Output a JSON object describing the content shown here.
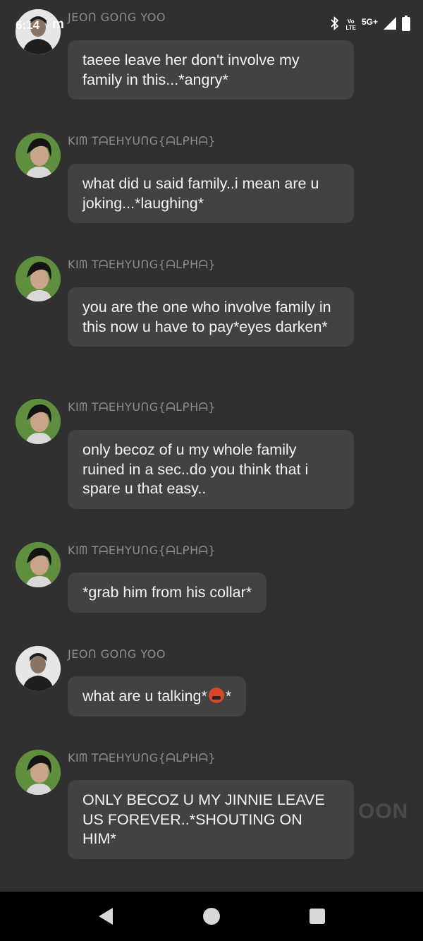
{
  "status_bar": {
    "time": "6:14",
    "app_icon": "m",
    "volte_top": "Vo",
    "volte_bottom": "LTE",
    "network": "5G+",
    "icons": [
      "bluetooth-icon",
      "signal-icon",
      "battery-icon"
    ]
  },
  "messages": [
    {
      "sender": "JEOᑎ GOᑎG YOO",
      "avatar": "gong-avatar",
      "text": "taeee leave her don't involve my family in this...*angry*"
    },
    {
      "sender": "KIᗰ TᗩEHYUᑎG{ᗩᒪᑭHᗩ}",
      "avatar": "taehyung-avatar",
      "text": "what did u said family..i mean are u joking...*laughing*"
    },
    {
      "sender": "KIᗰ TᗩEHYUᑎG{ᗩᒪᑭHᗩ}",
      "avatar": "taehyung-avatar",
      "text": "you are the one who involve family in this now u have to pay*eyes darken*"
    },
    {
      "sender": "KIᗰ TᗩEHYUᑎG{ᗩᒪᑭHᗩ}",
      "avatar": "taehyung-avatar",
      "text": "only becoz of u my whole family ruined in a sec..do you think that i spare u that easy.."
    },
    {
      "sender": "KIᗰ TᗩEHYUᑎG{ᗩᒪᑭHᗩ}",
      "avatar": "taehyung-avatar",
      "text": "*grab him from his collar*"
    },
    {
      "sender": "JEOᑎ GOᑎG YOO",
      "avatar": "gong-avatar",
      "text_before_emoji": "what are u talking*",
      "emoji": "cursing-face-emoji",
      "text_after_emoji": "*"
    },
    {
      "sender": "KIᗰ TᗩEHYUᑎG{ᗩᒪᑭHᗩ}",
      "avatar": "taehyung-avatar",
      "text": "ONLY BECOZ U MY JINNIE LEAVE US FOREVER..*SHOUTING ON HIM*"
    }
  ],
  "watermark": "OON",
  "nav_bar": {
    "icons": [
      "back-icon",
      "home-icon",
      "recents-icon"
    ]
  },
  "colors": {
    "background": "#303030",
    "bubble": "#424242",
    "sender_name": "#8d8d8d",
    "nav_bar": "#000000"
  }
}
